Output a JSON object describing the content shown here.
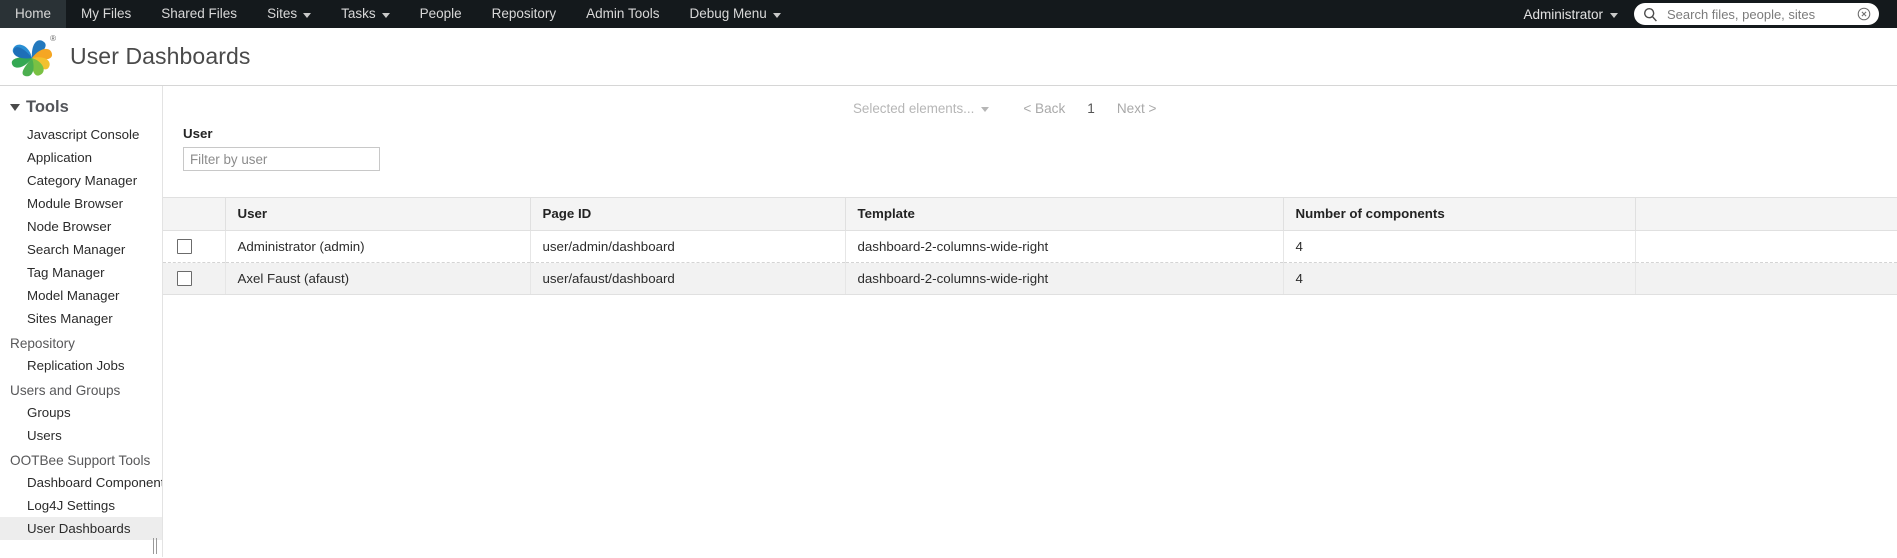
{
  "topnav": {
    "items": [
      {
        "label": "Home",
        "dropdown": false
      },
      {
        "label": "My Files",
        "dropdown": false
      },
      {
        "label": "Shared Files",
        "dropdown": false
      },
      {
        "label": "Sites",
        "dropdown": true
      },
      {
        "label": "Tasks",
        "dropdown": true
      },
      {
        "label": "People",
        "dropdown": false
      },
      {
        "label": "Repository",
        "dropdown": false
      },
      {
        "label": "Admin Tools",
        "dropdown": false
      },
      {
        "label": "Debug Menu",
        "dropdown": true
      }
    ],
    "user_menu_label": "Administrator",
    "search": {
      "placeholder": "Search files, people, sites",
      "value": "",
      "search_icon": "search-icon",
      "clear_icon": "clear-circle-icon"
    },
    "background": "#14191c"
  },
  "header": {
    "title": "User Dashboards",
    "logo_name": "alfresco-logo",
    "trademark": "®"
  },
  "sidebar": {
    "sections": [
      {
        "type": "section",
        "label": "Tools",
        "expanded": true,
        "items": [
          {
            "label": "Javascript Console",
            "active": false
          },
          {
            "label": "Application",
            "active": false
          },
          {
            "label": "Category Manager",
            "active": false
          },
          {
            "label": "Module Browser",
            "active": false
          },
          {
            "label": "Node Browser",
            "active": false
          },
          {
            "label": "Search Manager",
            "active": false
          },
          {
            "label": "Tag Manager",
            "active": false
          },
          {
            "label": "Model Manager",
            "active": false
          },
          {
            "label": "Sites Manager",
            "active": false
          }
        ]
      },
      {
        "type": "group",
        "label": "Repository",
        "items": [
          {
            "label": "Replication Jobs",
            "active": false
          }
        ]
      },
      {
        "type": "group",
        "label": "Users and Groups",
        "items": [
          {
            "label": "Groups",
            "active": false
          },
          {
            "label": "Users",
            "active": false
          }
        ]
      },
      {
        "type": "group",
        "label": "OOTBee Support Tools",
        "items": [
          {
            "label": "Dashboard Components",
            "active": false
          },
          {
            "label": "Log4J Settings",
            "active": false
          },
          {
            "label": "User Dashboards",
            "active": true
          }
        ]
      }
    ],
    "resize_grip": "sidebar-resize-grip"
  },
  "toolbar": {
    "selected_elements_label": "Selected elements...",
    "back_label": "< Back",
    "page_number": "1",
    "next_label": "Next >"
  },
  "filter": {
    "label": "User",
    "placeholder": "Filter by user",
    "value": ""
  },
  "table": {
    "columns": [
      {
        "key": "checkbox",
        "label": ""
      },
      {
        "key": "user",
        "label": "User"
      },
      {
        "key": "pageid",
        "label": "Page ID"
      },
      {
        "key": "template",
        "label": "Template"
      },
      {
        "key": "count",
        "label": "Number of components"
      },
      {
        "key": "extra",
        "label": ""
      }
    ],
    "rows": [
      {
        "checked": false,
        "user": "Administrator (admin)",
        "pageid": "user/admin/dashboard",
        "template": "dashboard-2-columns-wide-right",
        "count": "4",
        "extra": ""
      },
      {
        "checked": false,
        "user": "Axel Faust (afaust)",
        "pageid": "user/afaust/dashboard",
        "template": "dashboard-2-columns-wide-right",
        "count": "4",
        "extra": ""
      }
    ]
  }
}
